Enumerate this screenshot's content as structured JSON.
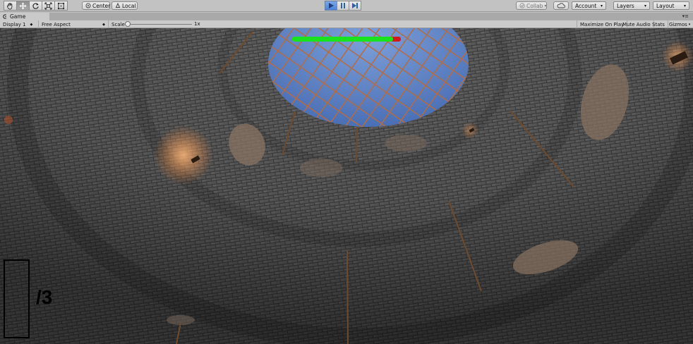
{
  "toolbar": {
    "pivot_label": "Center",
    "space_label": "Local",
    "collab_label": "Collab",
    "account_label": "Account",
    "layers_label": "Layers",
    "layout_label": "Layout"
  },
  "tab": {
    "title": "Game"
  },
  "gameview": {
    "display_label": "Display 1",
    "aspect_label": "Free Aspect",
    "scale_label": "Scale",
    "scale_value": "1x",
    "maximize_label": "Maximize On Play",
    "mute_label": "Mute Audio",
    "stats_label": "Stats",
    "gizmos_label": "Gizmos"
  },
  "hud": {
    "health_fraction": 0.93,
    "health_color": "#19e21e",
    "health_bg_color": "#d81818",
    "ammo_text": "/3"
  },
  "icons": [
    "hand-icon",
    "move-icon",
    "rotate-icon",
    "scale-icon",
    "rect-icon",
    "play-icon",
    "pause-icon",
    "step-icon",
    "cloud-icon",
    "game-tab-icon"
  ]
}
